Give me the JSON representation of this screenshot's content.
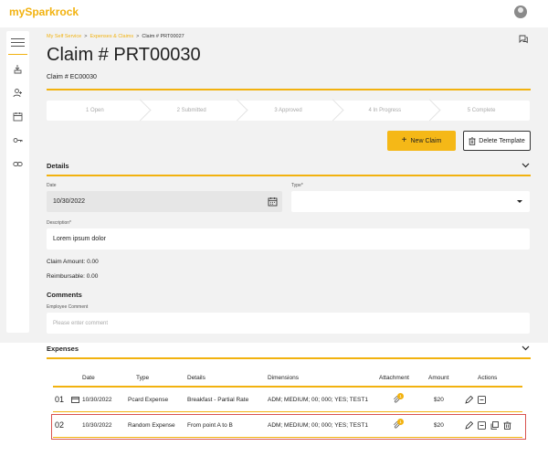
{
  "app": {
    "brand": "mySparkrock"
  },
  "breadcrumb": {
    "items": [
      "My Self Service",
      "Expenses & Claims",
      "Claim # PRT00027"
    ],
    "separator": ">"
  },
  "page": {
    "title": "Claim # PRT00030",
    "claim_sub": "Claim # EC00030"
  },
  "stepper": {
    "steps": [
      "1  Open",
      "2  Submitted",
      "3  Approved",
      "4  In Progress",
      "5  Complete"
    ]
  },
  "actions": {
    "new_claim": "New Claim",
    "new_claim_icon": "+",
    "delete_template": "Delete Template"
  },
  "details": {
    "title": "Details",
    "date_label": "Date",
    "date_value": "10/30/2022",
    "type_label": "Type*",
    "type_value": "",
    "description_label": "Description*",
    "description_value": "Lorem ipsum dolor",
    "claim_amount": "Claim Amount: 0.00",
    "reimbursable": "Reimbursable: 0.00"
  },
  "comments": {
    "title": "Comments",
    "employee_label": "Employee Comment",
    "placeholder": "Please enter comment"
  },
  "expenses": {
    "title": "Expenses",
    "columns": [
      "Date",
      "Type",
      "Details",
      "Dimensions",
      "Attachment",
      "Amount",
      "Actions"
    ],
    "rows": [
      {
        "num": "01",
        "date": "10/30/2022",
        "type": "Pcard Expense",
        "details": "Breakfast - Partial Rate",
        "dimensions": "ADM; MEDIUM; 00; 000; YES; TEST1",
        "attachment_count": "1",
        "amount": "$20",
        "pcard": true
      },
      {
        "num": "02",
        "date": "10/30/2022",
        "type": "Random Expense",
        "details": "From point A to B",
        "dimensions": "ADM; MEDIUM; 00; 000; YES; TEST1",
        "attachment_count": "1",
        "amount": "$20",
        "pcard": false
      }
    ]
  },
  "colors": {
    "accent": "#f2b20f",
    "button": "#f5b817",
    "highlight": "#d9534f",
    "background": "#f2f2f2"
  }
}
